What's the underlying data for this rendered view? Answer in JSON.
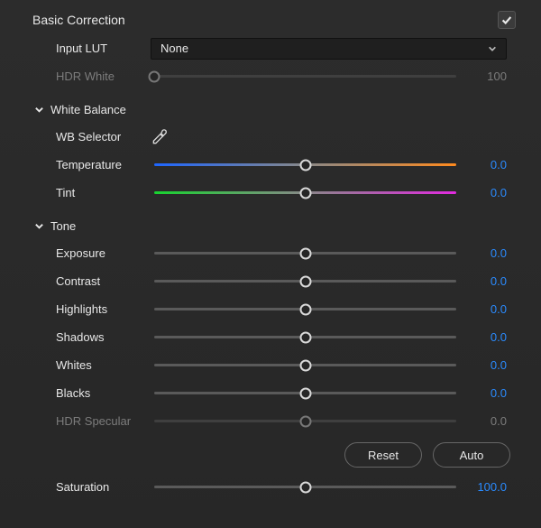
{
  "title": "Basic Correction",
  "enabled": true,
  "input_lut": {
    "label": "Input LUT",
    "value": "None"
  },
  "hdr_white": {
    "label": "HDR White",
    "value": "100",
    "pos": 0
  },
  "sections": {
    "white_balance": "White Balance",
    "tone": "Tone"
  },
  "wb_selector_label": "WB Selector",
  "sliders": {
    "temperature": {
      "label": "Temperature",
      "value": "0.0",
      "pos": 50
    },
    "tint": {
      "label": "Tint",
      "value": "0.0",
      "pos": 50
    },
    "exposure": {
      "label": "Exposure",
      "value": "0.0",
      "pos": 50
    },
    "contrast": {
      "label": "Contrast",
      "value": "0.0",
      "pos": 50
    },
    "highlights": {
      "label": "Highlights",
      "value": "0.0",
      "pos": 50
    },
    "shadows": {
      "label": "Shadows",
      "value": "0.0",
      "pos": 50
    },
    "whites": {
      "label": "Whites",
      "value": "0.0",
      "pos": 50
    },
    "blacks": {
      "label": "Blacks",
      "value": "0.0",
      "pos": 50
    },
    "hdr_specular": {
      "label": "HDR Specular",
      "value": "0.0",
      "pos": 50
    },
    "saturation": {
      "label": "Saturation",
      "value": "100.0",
      "pos": 50
    }
  },
  "buttons": {
    "reset": "Reset",
    "auto": "Auto"
  }
}
